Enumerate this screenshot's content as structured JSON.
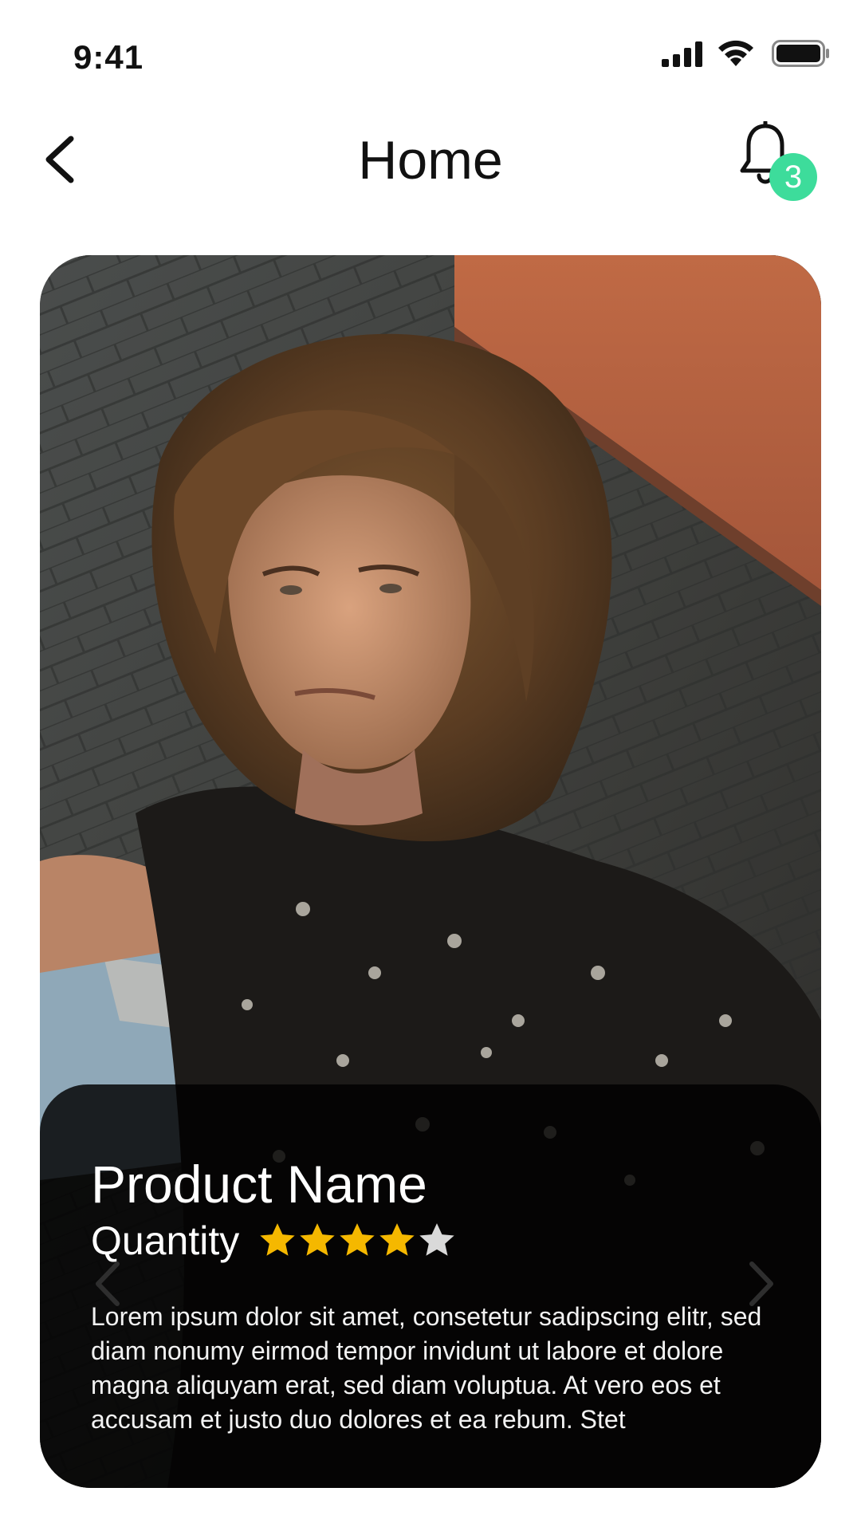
{
  "status_bar": {
    "time": "9:41",
    "icons": [
      "signal-icon",
      "wifi-icon",
      "battery-icon"
    ]
  },
  "header": {
    "title": "Home",
    "back_icon": "chevron-left-icon",
    "bell_icon": "bell-icon",
    "notification_count": "3",
    "badge_color": "#3ddc9b"
  },
  "card": {
    "image": "portrait-photo",
    "prev_icon": "chevron-left-icon",
    "next_icon": "chevron-right-icon",
    "product_name": "Product Name",
    "quantity_label": "Quantity",
    "rating": 4,
    "rating_max": 5,
    "star_color": "#f5b800",
    "star_empty_color": "#d9d9d9",
    "description": "Lorem ipsum dolor sit amet, consetetur sadipscing elitr, sed diam nonumy eirmod tempor invidunt ut labore et dolore magna aliquyam erat, sed diam voluptua. At vero eos et accusam et justo duo dolores et ea rebum. Stet"
  }
}
